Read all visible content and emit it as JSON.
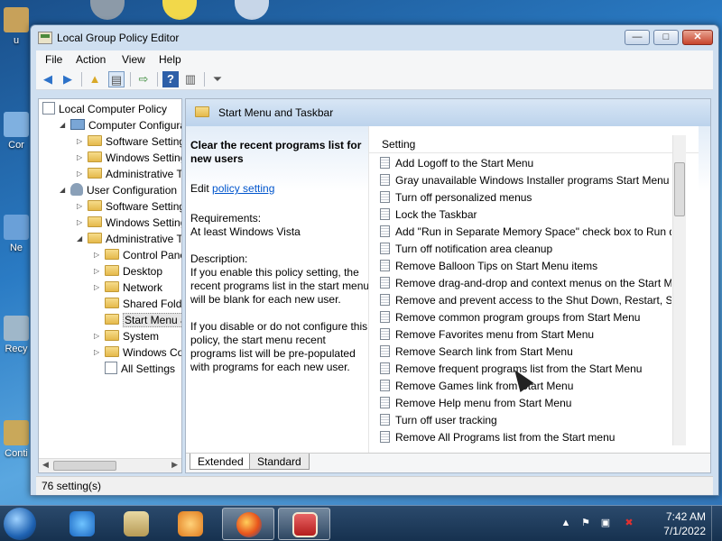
{
  "desktop": {
    "icons": [
      {
        "name": "user-folder-icon",
        "label": "u",
        "color": "#c7a15a"
      },
      {
        "name": "computer-icon",
        "label": "Cor",
        "color": "#7fb0e0"
      },
      {
        "name": "network-icon",
        "label": "Ne",
        "color": "#6aa0d8"
      },
      {
        "name": "recycle-bin-icon",
        "label": "Recy",
        "color": "#9fb7c9"
      },
      {
        "name": "control-panel-icon",
        "label": "Conti",
        "color": "#c9a85a"
      }
    ]
  },
  "window": {
    "title": "Local Group Policy Editor",
    "buttons": {
      "minimize": "—",
      "maximize": "□",
      "close": "✕"
    }
  },
  "menu": [
    "File",
    "Action",
    "View",
    "Help"
  ],
  "tree": {
    "items": [
      {
        "label": "Local Computer Policy",
        "icon": "policy",
        "indent": 0,
        "expander": ""
      },
      {
        "label": "Computer Configura",
        "icon": "pc",
        "indent": 1,
        "expander": "◢"
      },
      {
        "label": "Software Settings",
        "icon": "folder",
        "indent": 2,
        "expander": "▷"
      },
      {
        "label": "Windows Setting",
        "icon": "folder",
        "indent": 2,
        "expander": "▷"
      },
      {
        "label": "Administrative Te",
        "icon": "folder",
        "indent": 2,
        "expander": "▷"
      },
      {
        "label": "User Configuration",
        "icon": "user",
        "indent": 1,
        "expander": "◢"
      },
      {
        "label": "Software Settings",
        "icon": "folder",
        "indent": 2,
        "expander": "▷"
      },
      {
        "label": "Windows Setting",
        "icon": "folder",
        "indent": 2,
        "expander": "▷"
      },
      {
        "label": "Administrative Te",
        "icon": "folder",
        "indent": 2,
        "expander": "◢"
      },
      {
        "label": "Control Panel",
        "icon": "folder",
        "indent": 3,
        "expander": "▷"
      },
      {
        "label": "Desktop",
        "icon": "folder",
        "indent": 3,
        "expander": "▷"
      },
      {
        "label": "Network",
        "icon": "folder",
        "indent": 3,
        "expander": "▷"
      },
      {
        "label": "Shared Folder",
        "icon": "folder",
        "indent": 3,
        "expander": ""
      },
      {
        "label": "Start Menu ar",
        "icon": "folder",
        "indent": 3,
        "expander": "",
        "selected": true
      },
      {
        "label": "System",
        "icon": "folder",
        "indent": 3,
        "expander": "▷"
      },
      {
        "label": "Windows Cor",
        "icon": "folder",
        "indent": 3,
        "expander": "▷"
      },
      {
        "label": "All Settings",
        "icon": "policy",
        "indent": 3,
        "expander": ""
      }
    ]
  },
  "main": {
    "header": "Start Menu and Taskbar",
    "description": {
      "title": "Clear the recent programs list for new users",
      "edit_prefix": "Edit",
      "edit_link": "policy setting",
      "requirements_label": "Requirements:",
      "requirements_value": "At least Windows Vista",
      "description_label": "Description:",
      "para1": "If you enable this policy setting, the recent programs list in the start menu will be blank for each new user.",
      "para2": "If you disable or do not configure this policy, the start menu recent programs list will be pre-populated with programs for each new user."
    },
    "list": {
      "column": "Setting",
      "rows": [
        "Add Logoff to the Start Menu",
        "Gray unavailable Windows Installer programs Start Menu sh...",
        "Turn off personalized menus",
        "Lock the Taskbar",
        "Add \"Run in Separate Memory Space\" check box to Run dial...",
        "Turn off notification area cleanup",
        "Remove Balloon Tips on Start Menu items",
        "Remove drag-and-drop and context menus on the Start Me...",
        "Remove and prevent access to the Shut Down, Restart, Sleep...",
        "Remove common program groups from Start Menu",
        "Remove Favorites menu from Start Menu",
        "Remove Search link from Start Menu",
        "Remove frequent programs list from the Start Menu",
        "Remove Games link from Start Menu",
        "Remove Help menu from Start Menu",
        "Turn off user tracking",
        "Remove All Programs list from the Start menu"
      ]
    },
    "tabs": [
      "Extended",
      "Standard"
    ]
  },
  "status": "76 setting(s)",
  "taskbar": {
    "time": "7:42 AM",
    "date": "7/1/2022"
  }
}
